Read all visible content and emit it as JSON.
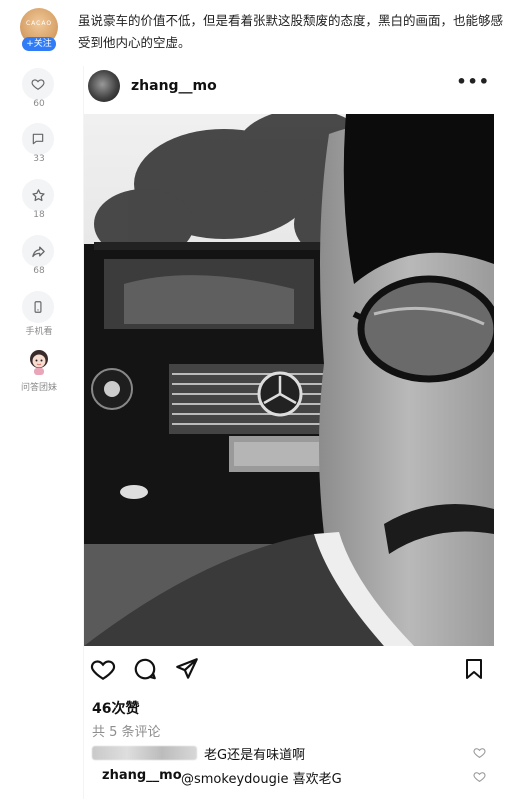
{
  "article": {
    "intro": "虽说豪车的价值不低，但是看着张默这股颓废的态度，黑白的画面，也能够感受到他内心的空虚。"
  },
  "author_rail": {
    "follow_label": "+关注",
    "like_count": "60",
    "comment_count": "33",
    "favorite_count": "18",
    "share_count": "68",
    "mobile_label": "手机看",
    "assistant_label": "问答团妹"
  },
  "post": {
    "username": "zhang__mo",
    "more_label": "•••",
    "likes": "46次赞",
    "comments_total": "共 5 条评论",
    "comments": [
      {
        "text": "老G还是有味道啊"
      },
      {
        "user": "zhang__mo",
        "text": "@smokeydougie 喜欢老G"
      }
    ]
  },
  "colors": {
    "accent": "#2f7cf6",
    "rail_button_bg": "#f3f4f6"
  }
}
